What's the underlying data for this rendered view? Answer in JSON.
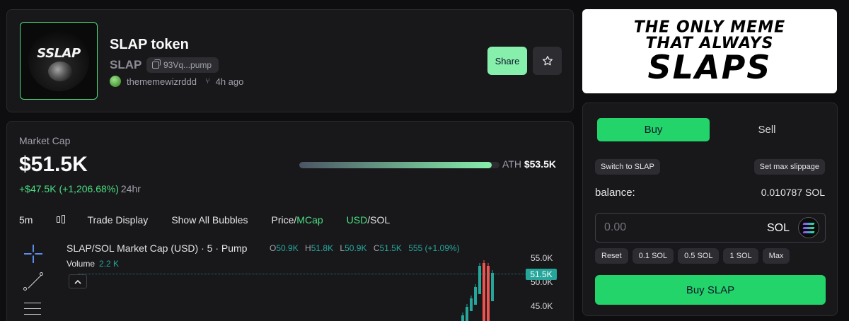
{
  "token": {
    "name": "SLAP token",
    "ticker": "SLAP",
    "logo_text": "SSLAP",
    "contract_short": "93Vq...pump",
    "creator": "thememewizrddd",
    "age": "4h ago",
    "share_label": "Share"
  },
  "market": {
    "label": "Market Cap",
    "value": "$51.5K",
    "change": "+$47.5K (+1,206.68%)",
    "period": "24hr",
    "ath_prefix": "ATH",
    "ath_value": "$53.5K",
    "ath_progress": 0.96
  },
  "toolbar": {
    "interval": "5m",
    "trade_display": "Trade Display",
    "bubbles": "Show All Bubbles",
    "price_label": "Price/",
    "mcap_label": "MCap",
    "usd_label": "USD",
    "sol_label": "/SOL"
  },
  "tv": {
    "title": "SLAP/SOL Market Cap (USD) · 5 · Pump",
    "o_key": "O",
    "o_val": "50.9K",
    "h_key": "H",
    "h_val": "51.8K",
    "l_key": "L",
    "l_val": "50.9K",
    "c_key": "C",
    "c_val": "51.5K",
    "change": "555 (+1.09%)",
    "volume_label": "Volume",
    "volume_value": "2.2 K",
    "axis": [
      "55.0K",
      "50.0K",
      "45.0K"
    ],
    "last_price": "51.5K"
  },
  "banner": {
    "line1": "THE ONLY MEME",
    "line2": "THAT ALWAYS",
    "line3": "SLAPS"
  },
  "trade": {
    "buy_tab": "Buy",
    "sell_tab": "Sell",
    "switch_label": "Switch to SLAP",
    "slippage_label": "Set max slippage",
    "balance_label": "balance:",
    "balance_value": "0.010787 SOL",
    "amount_placeholder": "0.00",
    "currency": "SOL",
    "quick": [
      "Reset",
      "0.1 SOL",
      "0.5 SOL",
      "1 SOL",
      "Max"
    ],
    "buy_button": "Buy SLAP"
  },
  "colors": {
    "accent_green": "#22d46a",
    "share_green": "#86efac",
    "candle_up": "#26a69a",
    "candle_down": "#ef5350"
  }
}
